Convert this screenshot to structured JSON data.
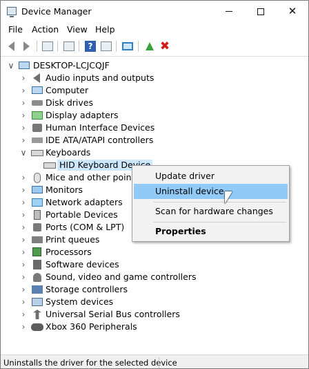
{
  "window": {
    "title": "Device Manager",
    "icons": {
      "app": "device-manager-icon",
      "minimize": "minimize-icon",
      "maximize": "maximize-icon",
      "close": "close-icon"
    }
  },
  "menu": [
    "File",
    "Action",
    "View",
    "Help"
  ],
  "toolbar": {
    "icons": [
      "back-arrow-icon",
      "forward-arrow-icon",
      "properties-sheet-icon",
      "show-hide-console-tree-icon",
      "help-icon",
      "action-pane-icon",
      "scan-hardware-monitor-icon",
      "update-driver-icon",
      "uninstall-device-icon"
    ],
    "colors": {
      "uninstall": "#d21d1d",
      "update": "#3aa13a",
      "help": "#2f5fb0"
    }
  },
  "tree": {
    "root": {
      "label": "DESKTOP-LCJCQJF",
      "icon": "computer-icon",
      "expanded": true
    },
    "categories": [
      {
        "label": "Audio inputs and outputs",
        "icon": "speaker-icon",
        "expanded": false
      },
      {
        "label": "Computer",
        "icon": "computer-icon",
        "expanded": false
      },
      {
        "label": "Disk drives",
        "icon": "disk-drive-icon",
        "expanded": false
      },
      {
        "label": "Display adapters",
        "icon": "display-adapter-icon",
        "expanded": false
      },
      {
        "label": "Human Interface Devices",
        "icon": "hid-icon",
        "expanded": false
      },
      {
        "label": "IDE ATA/ATAPI controllers",
        "icon": "ide-controller-icon",
        "expanded": false
      },
      {
        "label": "Keyboards",
        "icon": "keyboard-icon",
        "expanded": true
      },
      {
        "label": "Mice and other pointing",
        "icon": "mouse-icon",
        "expanded": false
      },
      {
        "label": "Monitors",
        "icon": "monitor-icon",
        "expanded": false
      },
      {
        "label": "Network adapters",
        "icon": "network-adapter-icon",
        "expanded": false
      },
      {
        "label": "Portable Devices",
        "icon": "portable-device-icon",
        "expanded": false
      },
      {
        "label": "Ports (COM & LPT)",
        "icon": "port-icon",
        "expanded": false
      },
      {
        "label": "Print queues",
        "icon": "printer-icon",
        "expanded": false
      },
      {
        "label": "Processors",
        "icon": "processor-icon",
        "expanded": false
      },
      {
        "label": "Software devices",
        "icon": "software-device-icon",
        "expanded": false
      },
      {
        "label": "Sound, video and game controllers",
        "icon": "sound-icon",
        "expanded": false
      },
      {
        "label": "Storage controllers",
        "icon": "storage-controller-icon",
        "expanded": false
      },
      {
        "label": "System devices",
        "icon": "system-device-icon",
        "expanded": false
      },
      {
        "label": "Universal Serial Bus controllers",
        "icon": "usb-icon",
        "expanded": false
      },
      {
        "label": "Xbox 360 Peripherals",
        "icon": "gamepad-icon",
        "expanded": false
      }
    ],
    "selected_child": {
      "label": "HID Keyboard Device",
      "icon": "keyboard-icon",
      "parent": "Keyboards"
    }
  },
  "context_menu": {
    "items": [
      {
        "label": "Update driver",
        "hover": false,
        "bold": false
      },
      {
        "label": "Uninstall device",
        "hover": true,
        "bold": false
      },
      {
        "label": "Scan for hardware changes",
        "hover": false,
        "bold": false
      },
      {
        "label": "Properties",
        "hover": false,
        "bold": true
      }
    ],
    "hover_color": "#91c9f7"
  },
  "status": {
    "text": "Uninstalls the driver for the selected device"
  },
  "colors": {
    "selection": "#cce8ff"
  }
}
